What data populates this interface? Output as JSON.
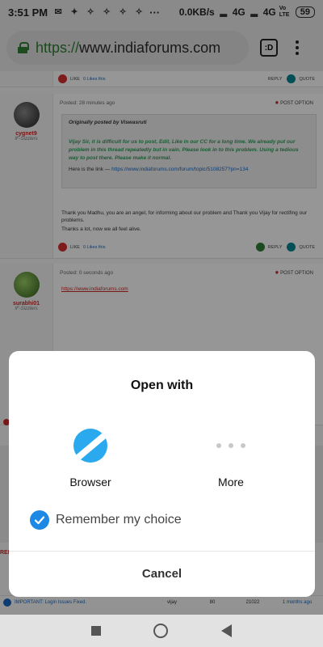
{
  "status_bar": {
    "time": "3:51 PM",
    "notif_icons": [
      "message-icon",
      "app-icon",
      "app-icon",
      "app-icon",
      "app-icon",
      "app-icon"
    ],
    "more": "···",
    "speed": "0.0KB/s",
    "network1": "4G",
    "network2": "4G",
    "volte": "Vo LTE",
    "battery": "59"
  },
  "browser": {
    "url_scheme": "https://",
    "url_host": "www.indiaforums.com",
    "tab_label": ":D"
  },
  "page": {
    "top_actions": {
      "like": "LIKE",
      "likes_count": "0 Likes this",
      "reply": "REPLY",
      "quote": "QUOTE"
    },
    "post1": {
      "username": "cygnet9",
      "role": "IF-Sizzlers",
      "posted": "Posted: 28 minutes ago",
      "post_option": "POST OPTION",
      "quote_header": "Originally posted by Viswasruti",
      "quote_body": "Vijay Sir, it is difficult for us to post, Edit, Like in our CC for a long time. We already put our problem in this thread repeatedly but in vain. Please look in to this problem. Using a tedious way to post there. Please make it normal.",
      "link_prefix": "Here is the link — ",
      "link_url": "https://www.indiaforums.com/forum/topic/5108257?pn=134",
      "text1": "Thank you Madhu, you are an angel, for informing about our problem and Thank you Vijay for rectifing our problems.",
      "text2": "Thanks a lot, now we all feel alive.",
      "like": "LIKE",
      "likes_count": "0 Likes this",
      "reply": "REPLY",
      "quote": "QUOTE"
    },
    "post2": {
      "username": "surabhi01",
      "role": "IF-Sizzlers",
      "posted": "Posted: 0 seconds ago",
      "post_option": "POST OPTION",
      "link": "https://www.indiaforums.com"
    },
    "table_row": {
      "title": "IMPORTANT: Login Issues Fixed.",
      "user": "vijay",
      "replies": "80",
      "views": "21022",
      "last": "1 months ago"
    },
    "rel_fragment": "REL"
  },
  "dialog": {
    "title": "Open with",
    "option_browser": "Browser",
    "option_more": "More",
    "remember_label": "Remember my choice",
    "remember_checked": true,
    "cancel": "Cancel",
    "accent_color": "#1e88e5"
  }
}
